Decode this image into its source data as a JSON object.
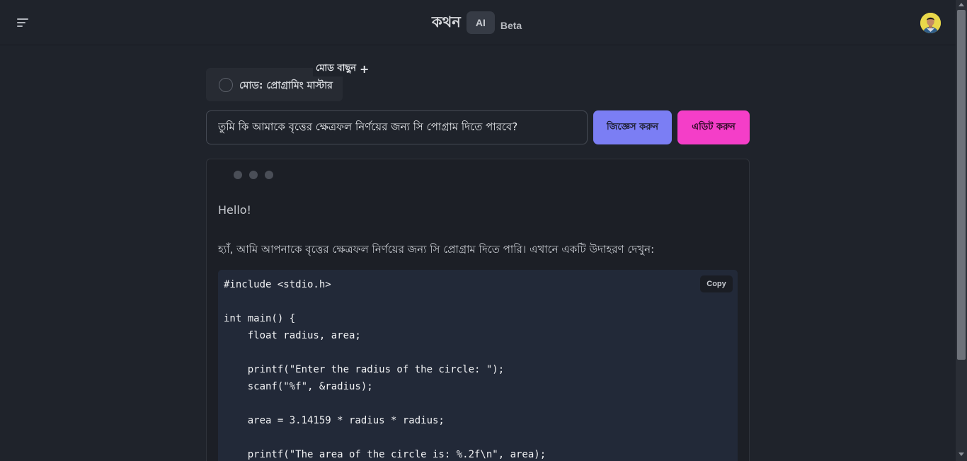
{
  "header": {
    "brand_name": "কথন",
    "brand_ai": "AI",
    "brand_beta": "Beta"
  },
  "mode": {
    "choose_label": "মোড বাছুন",
    "current_label": "মোড: প্রোগ্রামিং মাস্টার"
  },
  "query": {
    "value": "তুমি কি আমাকে বৃত্তের ক্ষেত্রফল নির্ণয়ের জন্য সি পোগ্রাম দিতে পারবে?",
    "ask_label": "জিজ্ঞেস করুন",
    "edit_label": "এডিট করুন"
  },
  "response": {
    "greeting": "Hello!",
    "intro": "হ্যাঁ, আমি আপনাকে বৃত্তের ক্ষেত্রফল নির্ণয়ের জন্য সি প্রোগ্রাম দিতে পারি। এখানে একটি উদাহরণ দেখুন:",
    "copy_label": "Copy",
    "code": "#include <stdio.h>\n\nint main() {\n    float radius, area;\n\n    printf(\"Enter the radius of the circle: \");\n    scanf(\"%f\", &radius);\n\n    area = 3.14159 * radius * radius;\n\n    printf(\"The area of the circle is: %.2f\\n\", area);"
  },
  "colors": {
    "background": "#1f232b",
    "ask_button": "#7b7ef4",
    "edit_button": "#f43ec8",
    "code_background": "#222938"
  },
  "icons": {
    "menu": "hamburger-menu-icon",
    "mode_radio": "radio-circle-icon",
    "plus": "plus-icon",
    "typing": "typing-dots-icon"
  }
}
